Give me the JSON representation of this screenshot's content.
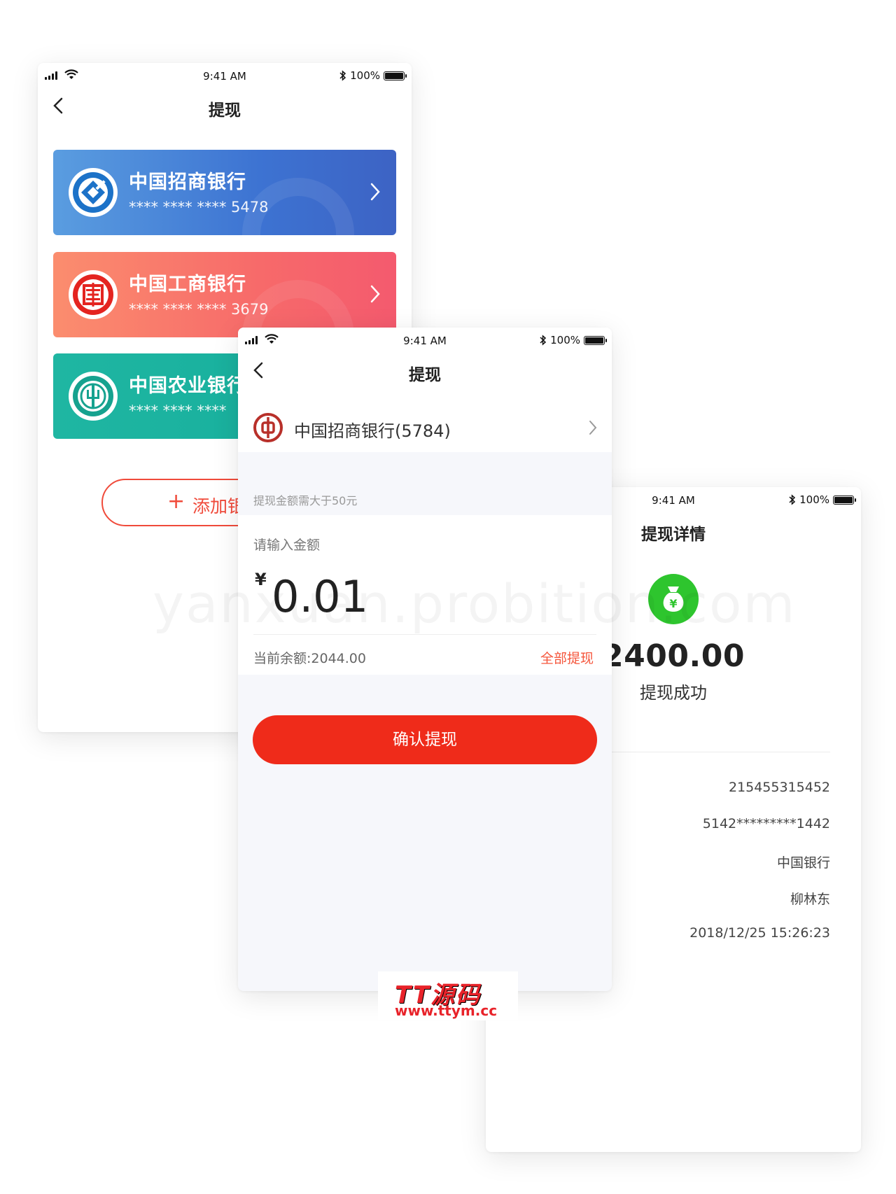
{
  "status": {
    "time": "9:41 AM",
    "battery": "100%"
  },
  "screen1": {
    "title": "提现",
    "cards": [
      {
        "name": "中国招商银行",
        "number": "**** **** **** 5478"
      },
      {
        "name": "中国工商银行",
        "number": "**** **** **** 3679"
      },
      {
        "name": "中国农业银行",
        "number": "**** **** ****"
      }
    ],
    "add_button": {
      "plus": "+",
      "label": "添加银行卡"
    }
  },
  "screen2": {
    "title": "提现",
    "bank": "中国招商银行(5784)",
    "hint": "提现金额需大于50元",
    "input_label": "请输入金额",
    "currency": "¥",
    "amount": "0.01",
    "balance": "当前余额:2044.00",
    "withdraw_all": "全部提现",
    "confirm": "确认提现"
  },
  "screen3": {
    "title": "提现详情",
    "amount": "2400.00",
    "result": "提现成功",
    "details": [
      "215455315452",
      "5142*********1442",
      "中国银行",
      "柳林东",
      "2018/12/25 15:26:23"
    ]
  },
  "watermark": "yanxuan.probition.com",
  "logo": {
    "cn": "TT源码",
    "url": "www.ttym.cc"
  },
  "colors": {
    "primary": "#ef2b1a",
    "success": "#2ec52e",
    "cmb": "#3d73d2",
    "icbc": "#f76a6a",
    "abc": "#15ad9b"
  }
}
